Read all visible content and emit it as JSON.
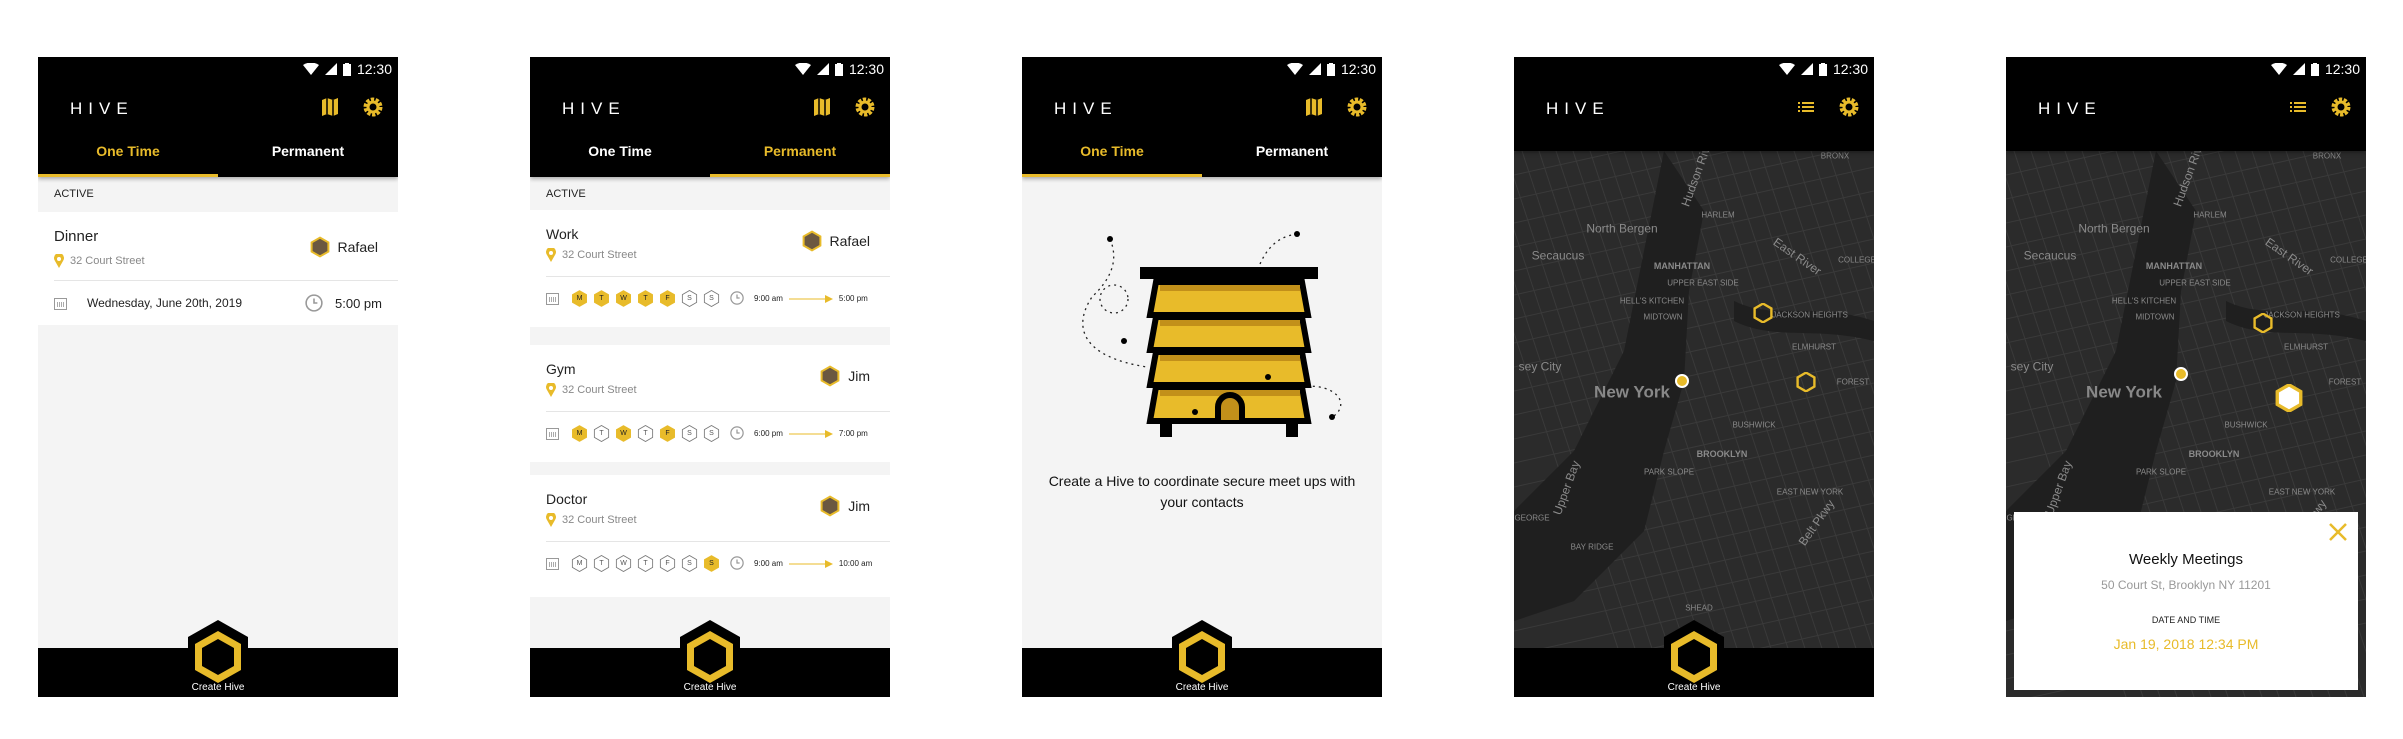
{
  "status": {
    "time": "12:30"
  },
  "app": {
    "title": "HIVE",
    "tabs": [
      "One Time",
      "Permanent"
    ],
    "fab_label": "Create Hive"
  },
  "colors": {
    "accent": "#e8bb2a",
    "header": "#000000",
    "map": "#2b2b2b"
  },
  "one_time": {
    "section": "ACTIVE",
    "item": {
      "title": "Dinner",
      "address": "32 Court Street",
      "contact": "Rafael",
      "date": "Wednesday, June 20th, 2019",
      "time": "5:00 pm"
    }
  },
  "permanent": {
    "section": "ACTIVE",
    "items": [
      {
        "title": "Work",
        "address": "32 Court Street",
        "contact": "Rafael",
        "days": [
          {
            "l": "M",
            "on": true
          },
          {
            "l": "T",
            "on": true
          },
          {
            "l": "W",
            "on": true
          },
          {
            "l": "T",
            "on": true
          },
          {
            "l": "F",
            "on": true
          },
          {
            "l": "S",
            "on": false
          },
          {
            "l": "S",
            "on": false
          }
        ],
        "start": "9:00 am",
        "end": "5:00 pm"
      },
      {
        "title": "Gym",
        "address": "32 Court Street",
        "contact": "Jim",
        "days": [
          {
            "l": "M",
            "on": true
          },
          {
            "l": "T",
            "on": false
          },
          {
            "l": "W",
            "on": true
          },
          {
            "l": "T",
            "on": false
          },
          {
            "l": "F",
            "on": true
          },
          {
            "l": "S",
            "on": false
          },
          {
            "l": "S",
            "on": false
          }
        ],
        "start": "6:00 pm",
        "end": "7:00 pm"
      },
      {
        "title": "Doctor",
        "address": "32 Court Street",
        "contact": "Jim",
        "days": [
          {
            "l": "M",
            "on": false
          },
          {
            "l": "T",
            "on": false
          },
          {
            "l": "W",
            "on": false
          },
          {
            "l": "T",
            "on": false
          },
          {
            "l": "F",
            "on": false
          },
          {
            "l": "S",
            "on": false
          },
          {
            "l": "S",
            "on": true
          }
        ],
        "start": "9:00 am",
        "end": "10:00 am"
      }
    ]
  },
  "empty": {
    "message": "Create a Hive to coordinate secure meet ups with your contacts"
  },
  "map": {
    "labels": [
      "BRONX",
      "North Bergen",
      "HARLEM",
      "Secaucus",
      "MANHATTAN",
      "UPPER EAST SIDE",
      "HELL'S KITCHEN",
      "MIDTOWN",
      "East River",
      "COLLEGE",
      "JACKSON HEIGHTS",
      "ELMHURST",
      "sey City",
      "New York",
      "FOREST",
      "BUSHWICK",
      "BROOKLYN",
      "PARK SLOPE",
      "EAST NEW YORK",
      "Upper Bay",
      "GEORGE",
      "BAY RIDGE",
      "Hudson River",
      "Belt Pkwy",
      "SHEAD"
    ]
  },
  "popup": {
    "title": "Weekly Meetings",
    "address": "50 Court St, Brooklyn NY 11201",
    "label": "DATE AND TIME",
    "datetime": "Jan 19, 2018 12:34 PM"
  }
}
